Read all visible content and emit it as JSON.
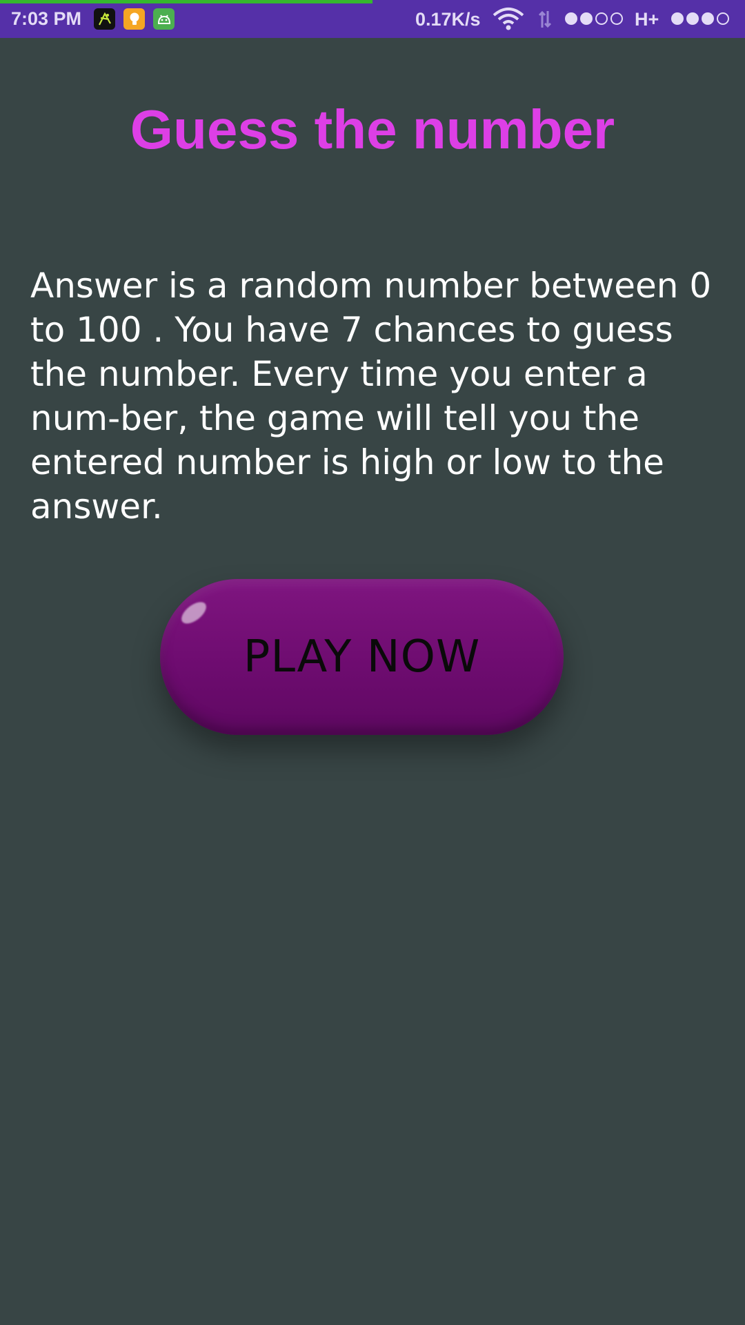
{
  "status_bar": {
    "time": "7:03 PM",
    "net_speed": "0.17K/s",
    "network_type": "H+",
    "notification_icons": [
      "cricket-app-icon",
      "lightbulb-app-icon",
      "android-app-icon"
    ],
    "accent_color": "#5530a8"
  },
  "main": {
    "title": "Guess the number",
    "description": "Answer is a random number between 0 to 100 . You have 7 chances to guess the number. Every time you enter a num-ber, the game will tell you the entered number is high or low to the answer.",
    "play_button_label": "PLAY NOW"
  },
  "colors": {
    "background": "#384545",
    "title": "#dd3fe6",
    "button": "#7a1280"
  }
}
